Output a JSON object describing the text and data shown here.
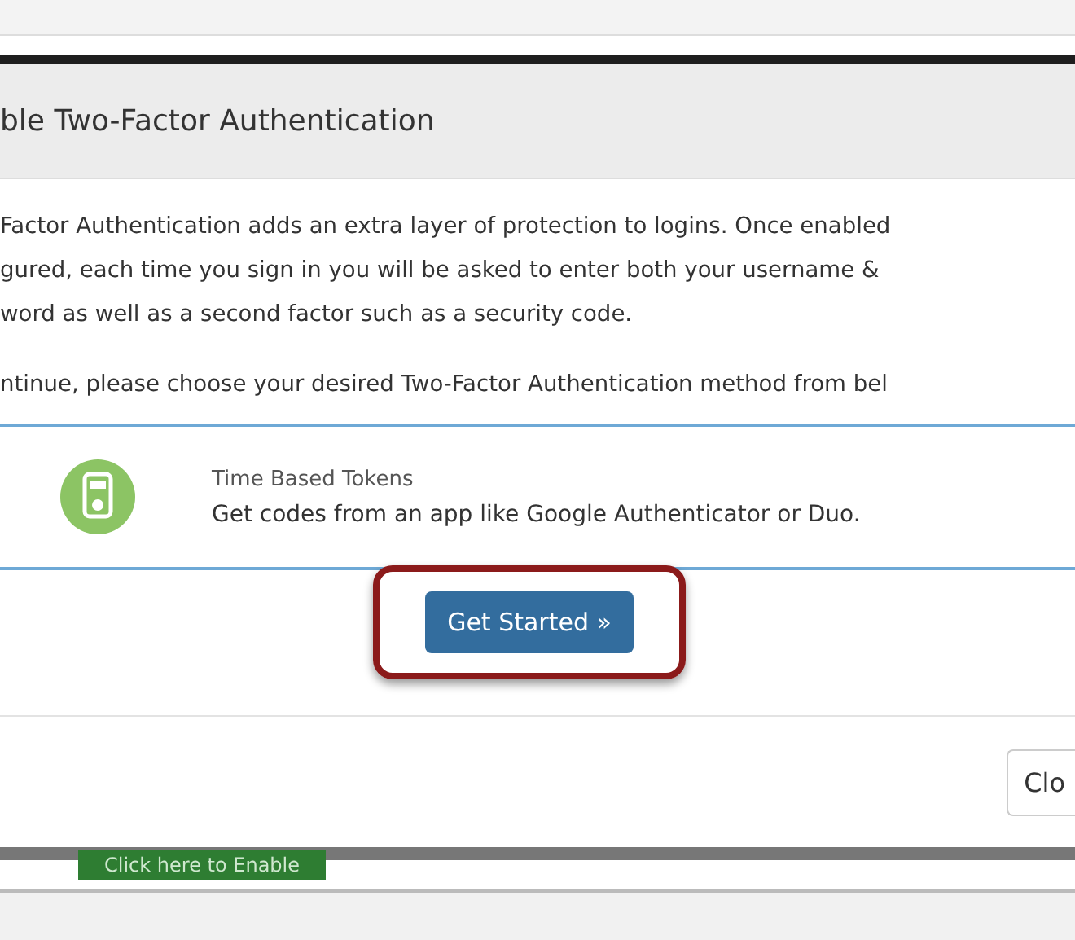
{
  "dialog": {
    "title": "ble Two-Factor Authentication",
    "intro_lines": [
      "Factor Authentication adds an extra layer of protection to logins. Once enabled",
      "gured, each time you sign in you will be asked to enter both your username &",
      "word as well as a second factor such as a security code."
    ],
    "prompt": "ntinue, please choose your desired Two-Factor Authentication method from bel",
    "methods": [
      {
        "title": "Time Based Tokens",
        "description": "Get codes from an app like Google Authenticator or Duo.",
        "selected": true
      }
    ],
    "primary_button": {
      "label": "Get Started »",
      "highlighted": true
    },
    "footer_button": "Clo"
  },
  "background": {
    "enable_button": "Click here to Enable"
  }
}
